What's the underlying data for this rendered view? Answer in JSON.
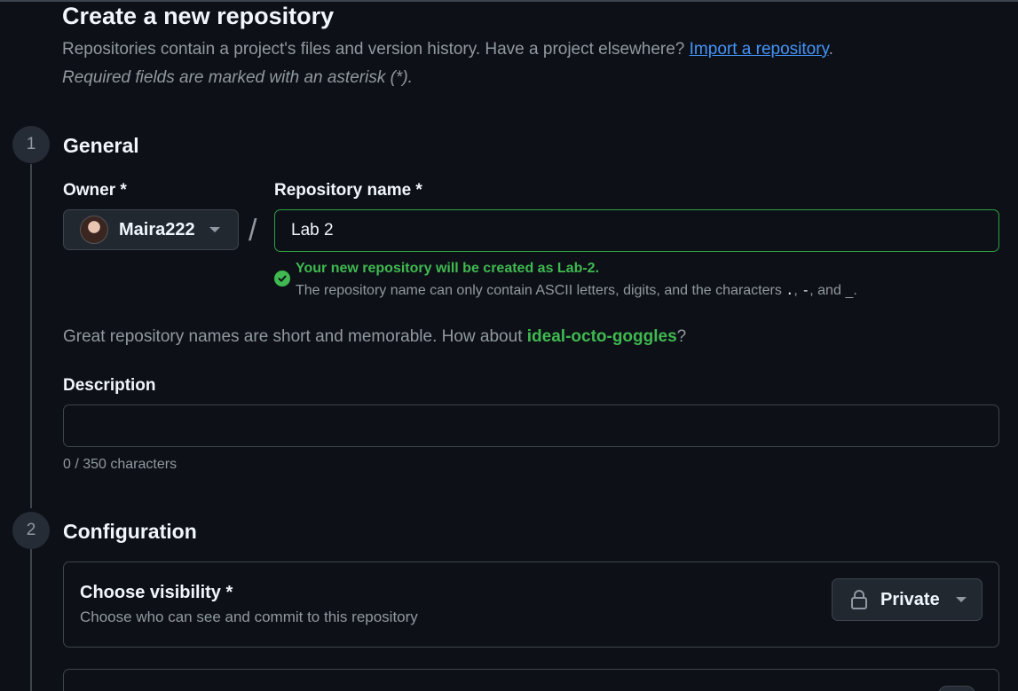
{
  "header": {
    "title": "Create a new repository",
    "subtitle_text": "Repositories contain a project's files and version history. Have a project elsewhere?",
    "import_link": "Import a repository",
    "subtitle_end": ".",
    "required_note": "Required fields are marked with an asterisk (*)."
  },
  "steps": [
    {
      "number": "1",
      "title": "General"
    },
    {
      "number": "2",
      "title": "Configuration"
    }
  ],
  "general": {
    "owner_label": "Owner *",
    "owner_value": "Maira222",
    "slash": "/",
    "repo_name_label": "Repository name *",
    "repo_name_value": "Lab 2",
    "success_message": "Your new repository will be created as Lab-2.",
    "hint_prefix": "The repository name can only contain ASCII letters, digits, and the characters",
    "hint_chars": [
      ".",
      "-",
      "_"
    ],
    "hint_sep1": ",",
    "hint_sep2": ", and",
    "hint_end": ".",
    "suggest_prefix": "Great repository names are short and memorable. How about",
    "suggest_name": "ideal-octo-goggles",
    "suggest_end": "?",
    "description_label": "Description",
    "description_value": "",
    "char_count": "0 / 350 characters"
  },
  "configuration": {
    "visibility_title": "Choose visibility *",
    "visibility_desc": "Choose who can see and commit to this repository",
    "visibility_value": "Private",
    "visibility_icon": "lock-icon"
  },
  "colors": {
    "background": "#0d1117",
    "success": "#3fb950",
    "link": "#4493f8",
    "border": "#3d444d"
  }
}
